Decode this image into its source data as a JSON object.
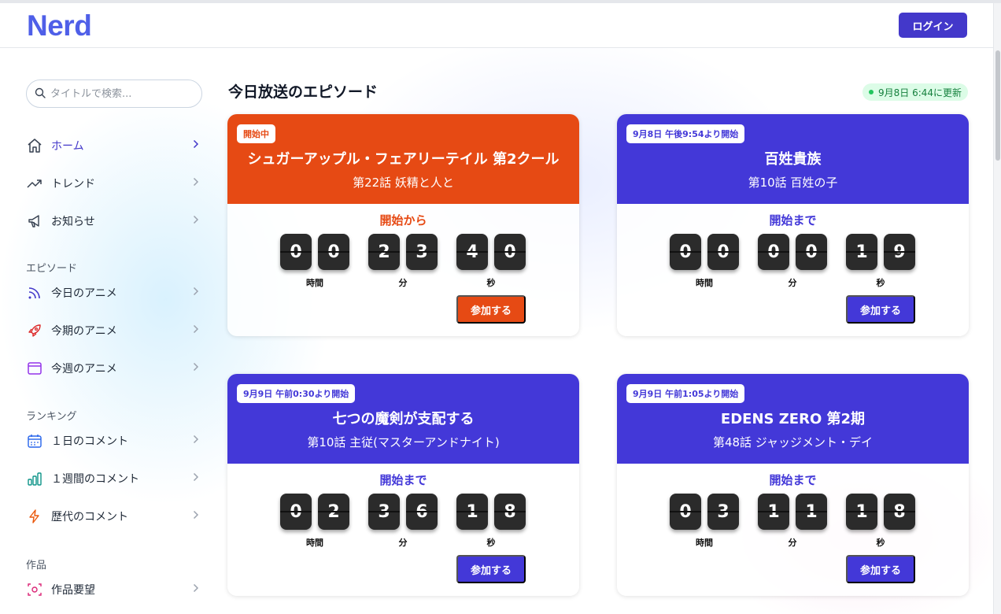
{
  "header": {
    "logo": "Nerd",
    "login_label": "ログイン"
  },
  "search": {
    "placeholder": "タイトルで検索..."
  },
  "sidebar": {
    "main_items": [
      {
        "label": "ホーム",
        "icon": "home-icon"
      },
      {
        "label": "トレンド",
        "icon": "trending-icon"
      },
      {
        "label": "お知らせ",
        "icon": "megaphone-icon"
      }
    ],
    "section_episodes": "エピソード",
    "episode_items": [
      {
        "label": "今日のアニメ",
        "icon": "rss-icon"
      },
      {
        "label": "今期のアニメ",
        "icon": "rocket-icon"
      },
      {
        "label": "今週のアニメ",
        "icon": "browser-window-icon"
      }
    ],
    "section_ranking": "ランキング",
    "ranking_items": [
      {
        "label": "１日のコメント",
        "icon": "calendar-icon"
      },
      {
        "label": "１週間のコメント",
        "icon": "bar-chart-icon"
      },
      {
        "label": "歴代のコメント",
        "icon": "lightning-icon"
      }
    ],
    "section_works": "作品",
    "works_items": [
      {
        "label": "作品要望",
        "icon": "focus-icon"
      }
    ]
  },
  "main": {
    "title": "今日放送のエピソード",
    "updated": "9月8日 6:44に更新",
    "units": {
      "hours": "時間",
      "minutes": "分",
      "seconds": "秒"
    },
    "join_label": "参加する",
    "cards": [
      {
        "badge": "開始中",
        "title": "シュガーアップル・フェアリーテイル 第2クール",
        "subtitle": "第22話  妖精と人と",
        "status": "開始から",
        "digits": [
          "0",
          "0",
          "2",
          "3",
          "4",
          "0"
        ],
        "color": "#e64a14"
      },
      {
        "badge": "9月8日 午後9:54より開始",
        "title": "百姓貴族",
        "subtitle": "第10話  百姓の子",
        "status": "開始まで",
        "digits": [
          "0",
          "0",
          "0",
          "0",
          "1",
          "9"
        ],
        "color": "#4338d8"
      },
      {
        "badge": "9月9日 午前0:30より開始",
        "title": "七つの魔剣が支配する",
        "subtitle": "第10話  主従(マスターアンドナイト)",
        "status": "開始まで",
        "digits": [
          "0",
          "2",
          "3",
          "6",
          "1",
          "8"
        ],
        "color": "#4338d8"
      },
      {
        "badge": "9月9日 午前1:05より開始",
        "title": "EDENS ZERO 第2期",
        "subtitle": "第48話  ジャッジメント・デイ",
        "status": "開始まで",
        "digits": [
          "0",
          "3",
          "1",
          "1",
          "1",
          "8"
        ],
        "color": "#4338d8"
      }
    ]
  }
}
